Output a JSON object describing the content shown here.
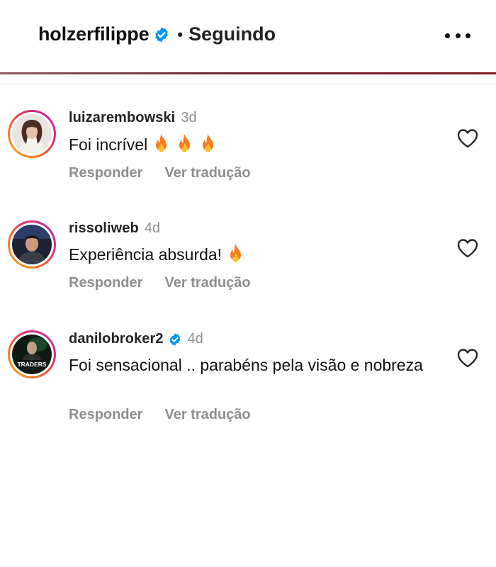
{
  "header": {
    "username": "holzerfilippe",
    "separator": "•",
    "follow_status": "Seguindo"
  },
  "comments": [
    {
      "username": "luizarembowski",
      "time": "3d",
      "text": "Foi incrível",
      "emoji_count": 3,
      "verified": false,
      "reply_label": "Responder",
      "translate_label": "Ver tradução"
    },
    {
      "username": "rissoliweb",
      "time": "4d",
      "text": "Experiência absurda!",
      "emoji_count": 1,
      "verified": false,
      "reply_label": "Responder",
      "translate_label": "Ver tradução"
    },
    {
      "username": "danilobroker2",
      "time": "4d",
      "text": "Foi sensacional .. parabéns pela visão e nobreza",
      "emoji_count": 0,
      "verified": true,
      "reply_label": "Responder",
      "translate_label": "Ver tradução",
      "avatar_text": "TRADERS"
    }
  ],
  "colors": {
    "verified_blue": "#0095f6",
    "muted_text": "#8e8e8e",
    "story_ring": [
      "#f9b21b",
      "#e1306c",
      "#c026a8"
    ]
  },
  "icons": [
    "verified-badge-icon",
    "more-options-icon",
    "heart-icon",
    "fire-emoji-icon"
  ]
}
